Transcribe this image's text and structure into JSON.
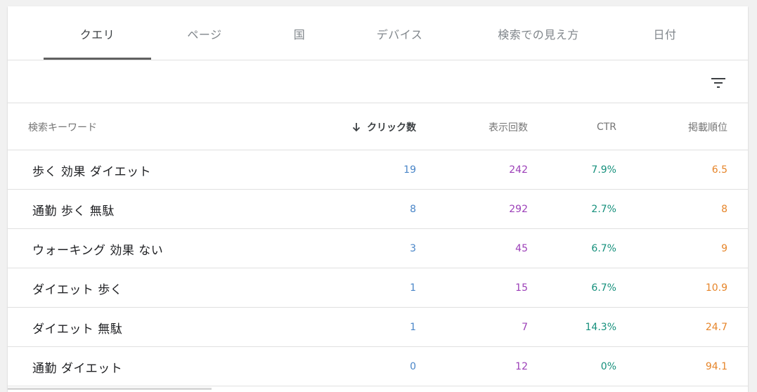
{
  "tabs": [
    {
      "label": "クエリ",
      "active": true
    },
    {
      "label": "ページ",
      "active": false
    },
    {
      "label": "国",
      "active": false
    },
    {
      "label": "デバイス",
      "active": false
    },
    {
      "label": "検索での見え方",
      "active": false
    },
    {
      "label": "日付",
      "active": false
    }
  ],
  "toolbar": {
    "filter_icon": "filter-list-icon"
  },
  "table": {
    "headers": {
      "query": "検索キーワード",
      "clicks": "クリック数",
      "impressions": "表示回数",
      "ctr": "CTR",
      "position": "掲載順位"
    },
    "sort": {
      "column": "clicks",
      "direction": "descending",
      "icon": "arrow-down-icon"
    },
    "rows": [
      {
        "query": "歩く 効果 ダイエット",
        "clicks": "19",
        "impressions": "242",
        "ctr": "7.9%",
        "position": "6.5"
      },
      {
        "query": "通勤 歩く 無駄",
        "clicks": "8",
        "impressions": "292",
        "ctr": "2.7%",
        "position": "8"
      },
      {
        "query": "ウォーキング 効果 ない",
        "clicks": "3",
        "impressions": "45",
        "ctr": "6.7%",
        "position": "9"
      },
      {
        "query": "ダイエット 歩く",
        "clicks": "1",
        "impressions": "15",
        "ctr": "6.7%",
        "position": "10.9"
      },
      {
        "query": "ダイエット 無駄",
        "clicks": "1",
        "impressions": "7",
        "ctr": "14.3%",
        "position": "24.7"
      },
      {
        "query": "通勤 ダイエット",
        "clicks": "0",
        "impressions": "12",
        "ctr": "0%",
        "position": "94.1"
      }
    ]
  },
  "colors": {
    "clicks": "#4a86c8",
    "impressions": "#9c3fb8",
    "ctr": "#16907c",
    "position": "#e6852a"
  }
}
